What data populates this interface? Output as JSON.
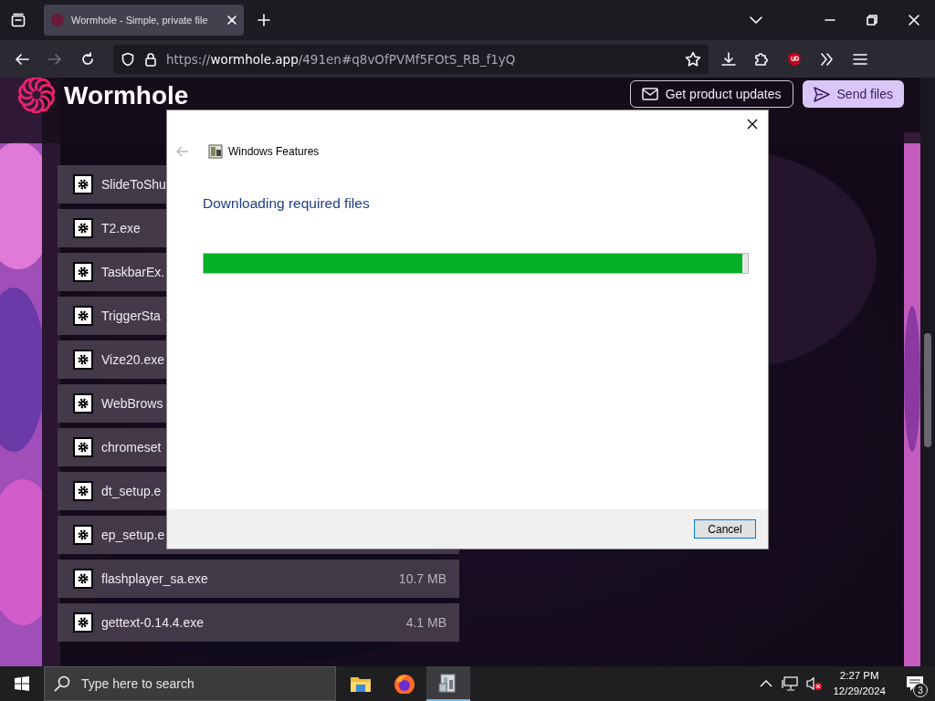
{
  "browser": {
    "tabs": [
      {
        "title": "Wormhole - Simple, private file",
        "selected": true
      }
    ],
    "nav_buttons": [
      {
        "kind": "back",
        "disabled": false
      },
      {
        "kind": "forward",
        "disabled": true
      },
      {
        "kind": "reload",
        "disabled": false
      }
    ],
    "url": {
      "scheme": "https://",
      "host": "wormhole.app",
      "path": "/491en#q8vOfPVMf5FOtS_RB_f1yQ"
    }
  },
  "page": {
    "logo": "Wormhole",
    "header_buttons": [
      {
        "label": "Get product updates",
        "kind": "outline"
      },
      {
        "label": "Send files",
        "kind": "primary"
      }
    ],
    "files": [
      {
        "name": "SlideToShu"
      },
      {
        "name": "T2.exe"
      },
      {
        "name": "TaskbarEx."
      },
      {
        "name": "TriggerSta"
      },
      {
        "name": "Vize20.exe"
      },
      {
        "name": "WebBrows"
      },
      {
        "name": "chromeset"
      },
      {
        "name": "dt_setup.e"
      },
      {
        "name": "ep_setup.e"
      },
      {
        "name": "flashplayer_sa.exe",
        "size": "10.7 MB"
      },
      {
        "name": "gettext-0.14.4.exe",
        "size": "4.1 MB"
      }
    ]
  },
  "dialog": {
    "title": "Windows Features",
    "back_disabled": true,
    "heading": "Downloading required files",
    "progress": {
      "level": 0.99
    },
    "buttons": [
      "Cancel"
    ]
  },
  "taskbar": {
    "search_placeholder": "Type here to search",
    "apps": [
      {
        "kind": "explorer",
        "selected": false
      },
      {
        "kind": "firefox",
        "selected": false
      },
      {
        "kind": "features",
        "selected": true
      }
    ],
    "volume_muted": true,
    "time": "2:27 PM",
    "date": "12/29/2024",
    "notifications": "3"
  }
}
